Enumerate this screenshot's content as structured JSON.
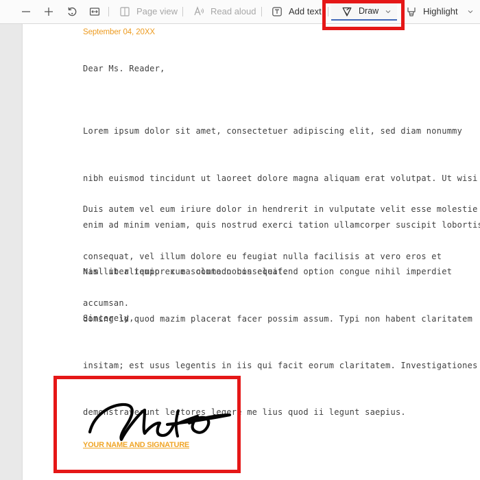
{
  "toolbar": {
    "zoom_out_icon": "minus-icon",
    "zoom_in_icon": "plus-icon",
    "rotate_icon": "rotate-icon",
    "fit_icon": "fit-page-icon",
    "page_view_label": "Page view",
    "read_aloud_label": "Read aloud",
    "add_text_label": "Add text",
    "draw_label": "Draw",
    "highlight_label": "Highlight",
    "disabled_color": "#a7a7a7",
    "accent_color": "#3f67b8"
  },
  "highlights": {
    "color": "#e51717"
  },
  "document": {
    "date": "September 04, 20XX",
    "salutation": "Dear Ms. Reader,",
    "paragraphs": [
      [
        "Lorem ipsum dolor sit amet, consectetuer adipiscing elit, sed diam nonummy",
        "nibh euismod tincidunt ut laoreet dolore magna aliquam erat volutpat. Ut wisi",
        "enim ad minim veniam, quis nostrud exerci tation ullamcorper suscipit lobortis",
        "nisl ut aliquip ex ea commodo consequat."
      ],
      [
        "Duis autem vel eum iriure dolor in hendrerit in vulputate velit esse molestie",
        "consequat, vel illum dolore eu feugiat nulla facilisis at vero eros et",
        "accumsan."
      ],
      [
        "Nam liber tempor cum soluta nobis eleifend option congue nihil imperdiet",
        "doming id quod mazim placerat facer possim assum. Typi non habent claritatem",
        "insitam; est usus legentis in iis qui facit eorum claritatem. Investigationes",
        "demonstraverunt lectores legere me lius quod ii legunt saepius."
      ]
    ],
    "closing": "Sincerely,",
    "signature_caption": "YOUR NAME AND SIGNATURE",
    "accent_color": "#ed9b20",
    "text_color": "#404040"
  }
}
